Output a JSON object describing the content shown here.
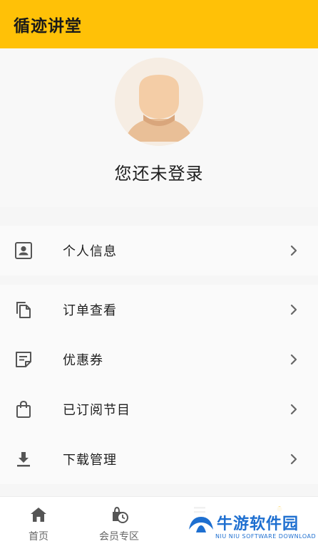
{
  "header": {
    "title": "循迹讲堂"
  },
  "profile": {
    "login_prompt": "您还未登录"
  },
  "menu_group_1": [
    {
      "label": "个人信息",
      "icon": "contact-card-icon"
    }
  ],
  "menu_group_2": [
    {
      "label": "订单查看",
      "icon": "copy-documents-icon"
    },
    {
      "label": "优惠券",
      "icon": "coupon-note-icon"
    },
    {
      "label": "已订阅节目",
      "icon": "shopping-bag-icon"
    },
    {
      "label": "下载管理",
      "icon": "download-icon"
    }
  ],
  "tabbar": {
    "tabs": [
      {
        "label": "首页",
        "icon": "home-icon"
      },
      {
        "label": "会员专区",
        "icon": "member-clock-icon"
      },
      {
        "label": "",
        "icon": "list-icon"
      },
      {
        "label": "",
        "icon": "profile-icon"
      }
    ]
  },
  "watermark": {
    "title": "牛游软件园",
    "subtitle": "NIU NIU SOFTWARE DOWNLOAD"
  },
  "colors": {
    "accent": "#ffc107",
    "icon_gray": "#555555",
    "watermark_blue": "#1e6fd0"
  }
}
